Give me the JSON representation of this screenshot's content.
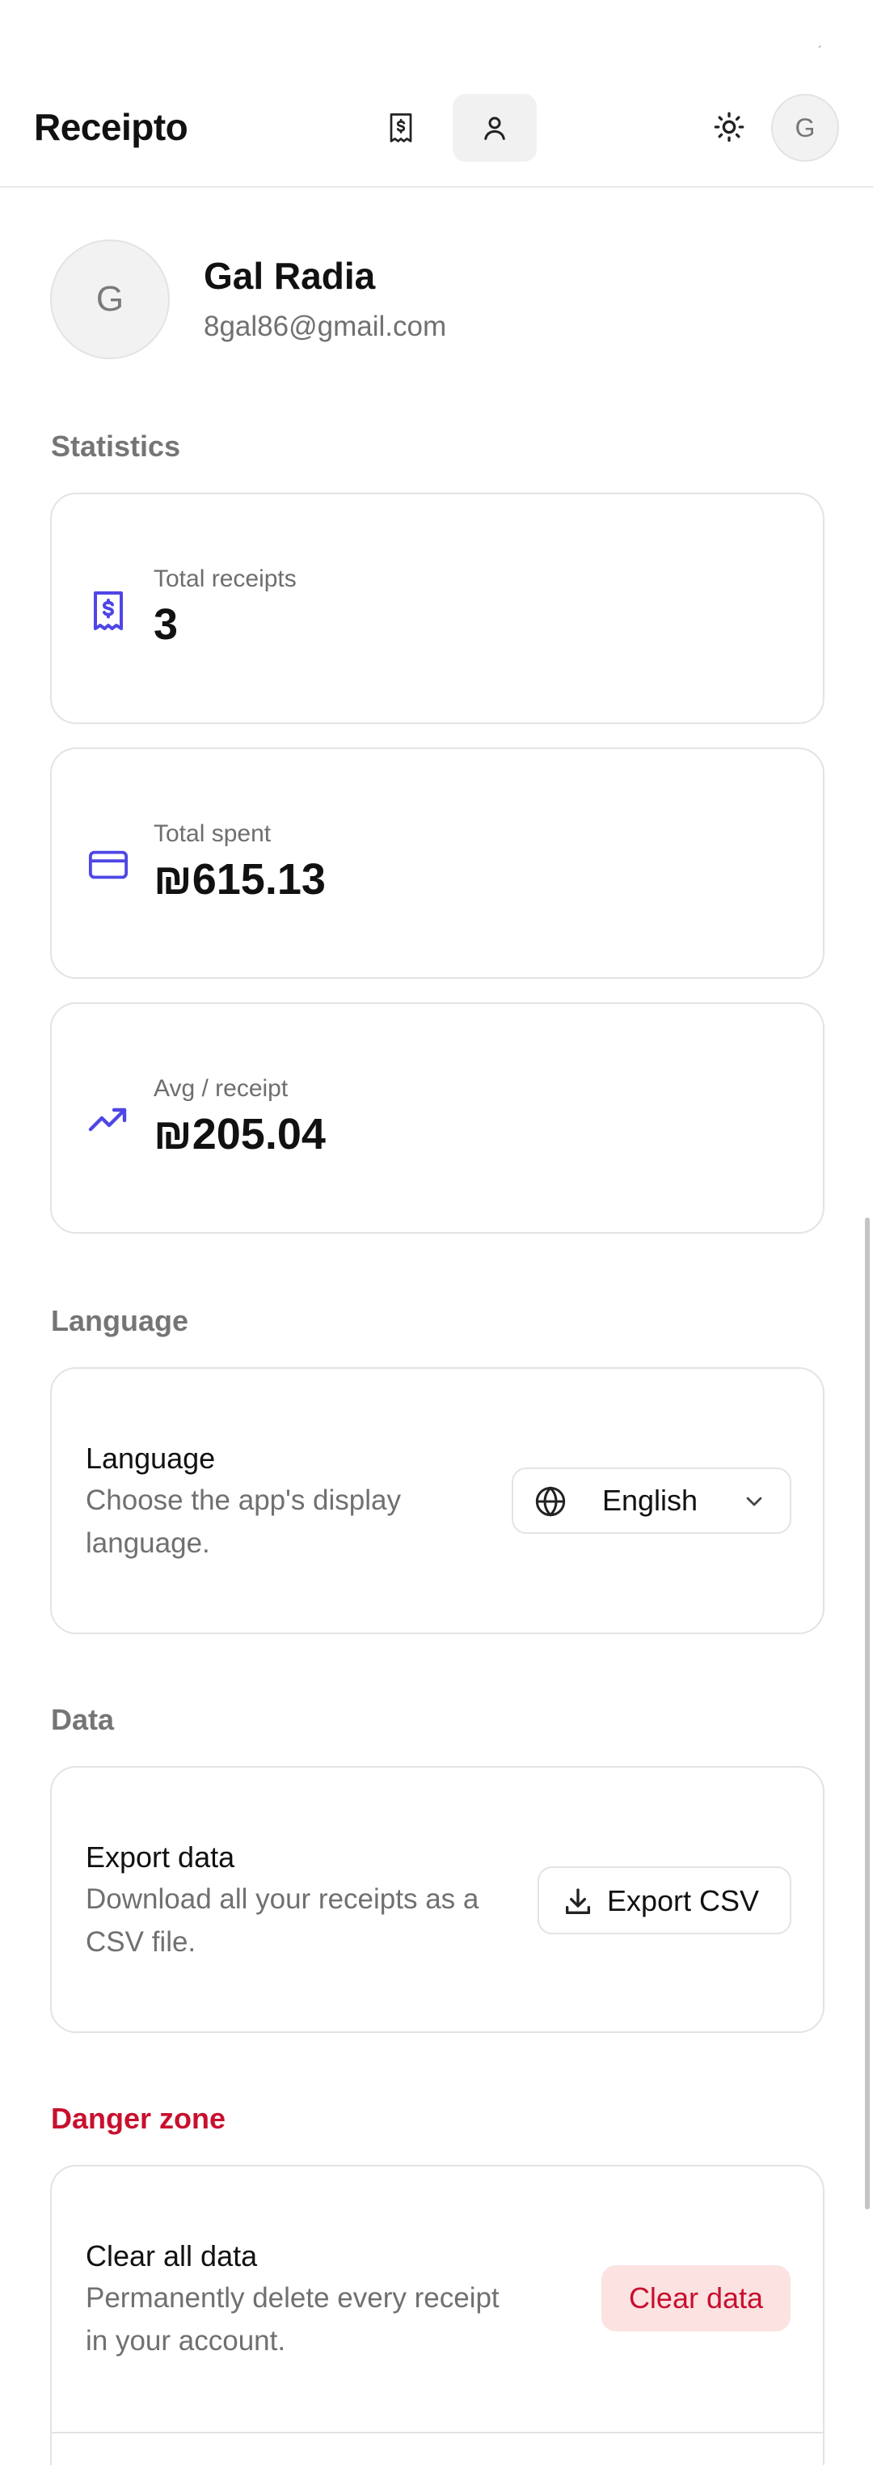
{
  "app": {
    "title": "Receipto"
  },
  "header": {
    "avatar_initial": "G",
    "colors": {
      "active_nav_bg": "#f1f1f1",
      "accent": "#4f46e5"
    }
  },
  "profile": {
    "initial": "G",
    "name": "Gal Radia",
    "email": "8gal86@gmail.com"
  },
  "statistics": {
    "title": "Statistics",
    "items": [
      {
        "icon": "receipt-icon",
        "label": "Total receipts",
        "value": "3"
      },
      {
        "icon": "credit-card-icon",
        "label": "Total spent",
        "value": "₪615.13"
      },
      {
        "icon": "trending-up-icon",
        "label": "Avg / receipt",
        "value": "₪205.04"
      }
    ]
  },
  "language": {
    "section_title": "Language",
    "row_title": "Language",
    "row_description": "Choose the app's display language.",
    "selected": "English"
  },
  "data_section": {
    "section_title": "Data",
    "row_title": "Export data",
    "row_description": "Download all your receipts as a CSV file.",
    "button_label": "Export CSV"
  },
  "danger_zone": {
    "section_title": "Danger zone",
    "row_title": "Clear all data",
    "row_description": "Permanently delete every receipt in your account.",
    "button_label": "Clear data",
    "colors": {
      "danger_text": "#c8102e",
      "danger_bg": "#fde2e2"
    }
  }
}
